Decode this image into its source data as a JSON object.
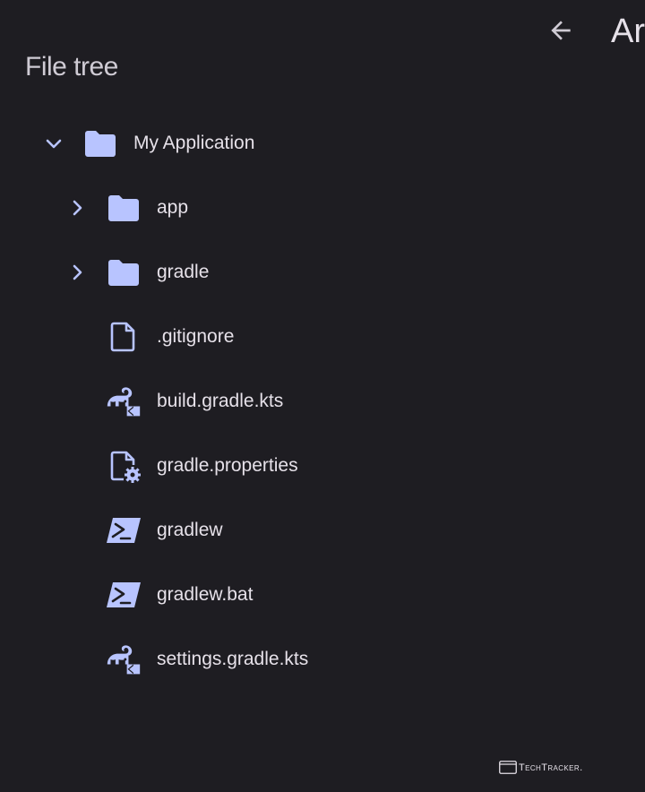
{
  "panel": {
    "title": "File tree"
  },
  "header": {
    "title": "Ar",
    "back_icon": "arrow-back-icon"
  },
  "tree": {
    "root": {
      "label": "My Application",
      "icon": "folder-icon",
      "expanded": true
    },
    "children": [
      {
        "label": "app",
        "icon": "folder-icon",
        "expandable": true,
        "expanded": false
      },
      {
        "label": "gradle",
        "icon": "folder-icon",
        "expandable": true,
        "expanded": false
      },
      {
        "label": ".gitignore",
        "icon": "file-icon",
        "expandable": false
      },
      {
        "label": "build.gradle.kts",
        "icon": "gradle-kotlin-icon",
        "expandable": false
      },
      {
        "label": "gradle.properties",
        "icon": "file-settings-icon",
        "expandable": false
      },
      {
        "label": "gradlew",
        "icon": "terminal-icon",
        "expandable": false
      },
      {
        "label": "gradlew.bat",
        "icon": "terminal-icon",
        "expandable": false
      },
      {
        "label": "settings.gradle.kts",
        "icon": "gradle-kotlin-icon",
        "expandable": false
      }
    ]
  },
  "watermark": {
    "text": "TechTracker."
  },
  "colors": {
    "background": "#1e1d22",
    "icon_accent": "#b8c4ff",
    "text_primary": "#e6e1e9"
  }
}
